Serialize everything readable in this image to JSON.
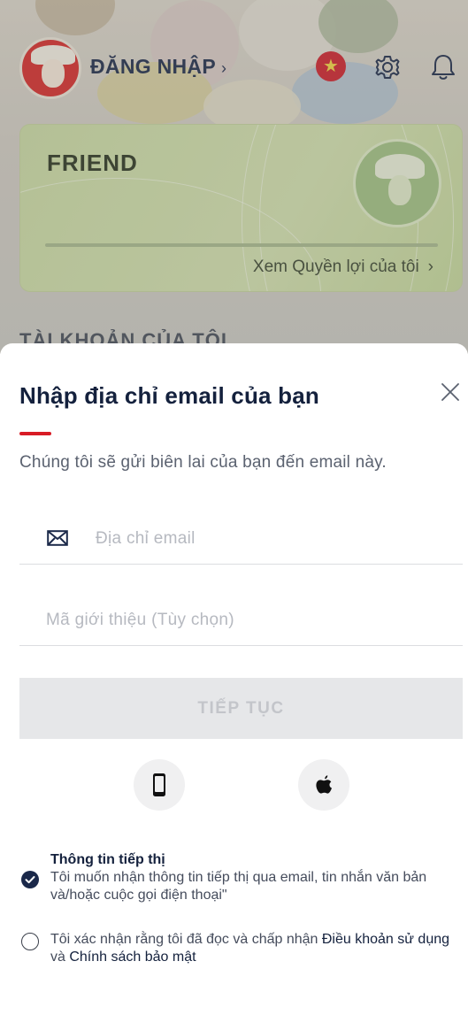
{
  "header": {
    "login_label": "ĐĂNG NHẬP",
    "login_chevron": "›",
    "icons": [
      "vietnam-flag-icon",
      "gear-icon",
      "bell-icon"
    ],
    "flag_star": "★"
  },
  "membership_card": {
    "tier": "FRIEND",
    "benefits_link": "Xem Quyền lợi của tôi",
    "benefits_chevron": "›"
  },
  "background_section_title": "TÀI KHOẢN CỦA TÔI",
  "sheet": {
    "title": "Nhập địa chỉ email của bạn",
    "subtitle": "Chúng tôi sẽ gửi biên lai của bạn đến email này.",
    "email_placeholder": "Địa chỉ email",
    "email_value": "",
    "referral_placeholder": "Mã giới thiệu (Tùy chọn)",
    "referral_value": "",
    "submit_label": "TIẾP TỤC",
    "social_buttons": [
      "phone-login",
      "apple-login"
    ],
    "marketing": {
      "title": "Thông tin tiếp thị",
      "text": "Tôi muốn nhận thông tin tiếp thị qua email, tin nhắn văn bản và/hoặc cuộc gọi điện thoại\"",
      "checked": true
    },
    "terms": {
      "prefix": "Tôi xác nhận rằng tôi đã đọc và chấp nhận ",
      "terms_link": "Điều khoản sử dụng",
      "and": " và ",
      "privacy_link": "Chính sách bảo mật",
      "checked": false
    }
  },
  "colors": {
    "accent_red": "#d81b25",
    "navy": "#14213d",
    "card_green": "#c9d9a3",
    "disabled_button": "#e6e7e9"
  }
}
